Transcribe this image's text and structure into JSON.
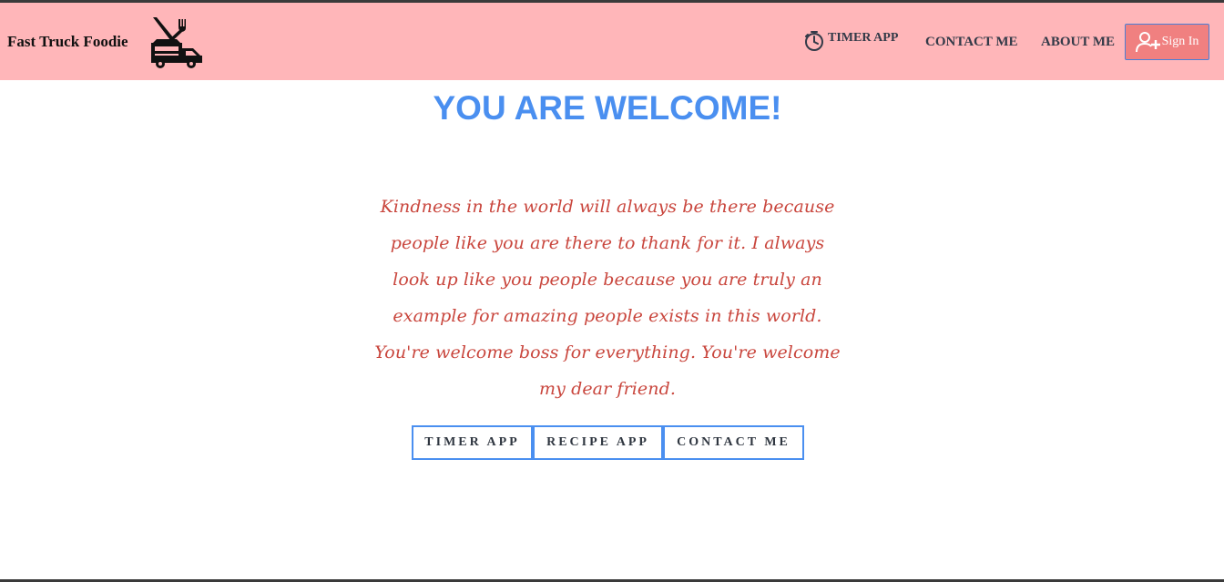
{
  "navbar": {
    "brand": "Fast Truck Foodie",
    "logo_icon": "food-truck-fork-knife-icon",
    "links": {
      "timer_icon": "stopwatch-icon",
      "timer": "TIMER APP",
      "contact": "CONTACT ME",
      "about": "ABOUT ME"
    },
    "signin": {
      "icon": "add-user-icon",
      "label": "Sign In"
    }
  },
  "main": {
    "heading": "YOU ARE WELCOME!",
    "message_lines": [
      "Kindness in the world will always be there because people like you are there to thank for it. I always look up like you people because you are truly an example for amazing people exists in this world.",
      "You're welcome boss for everything. You're welcome my dear friend."
    ],
    "buttons": {
      "timer": "TIMER APP",
      "recipe": "RECIPE APP",
      "contact": "CONTACT ME"
    }
  },
  "colors": {
    "navbar_bg": "#ffb6b9",
    "heading": "#4a8ff0",
    "message": "#c9463d",
    "signin_bg": "#f08080",
    "button_border": "#4a8ff0"
  }
}
